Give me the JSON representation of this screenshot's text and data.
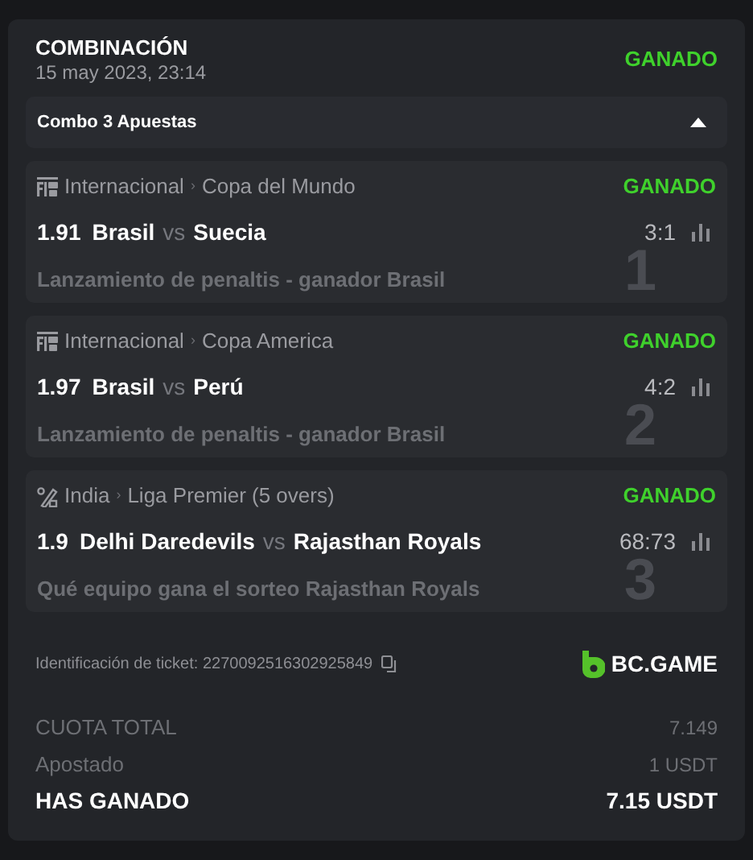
{
  "header": {
    "title": "COMBINACIÓN",
    "date": "15 may 2023, 23:14",
    "status": "GANADO"
  },
  "combo": {
    "label": "Combo 3 Apuestas",
    "expanded": true
  },
  "bets": [
    {
      "kind": "fifa",
      "country": "Internacional",
      "separator": "›",
      "league": "Copa del Mundo",
      "status": "GANADO",
      "odds": "1.91",
      "home": "Brasil",
      "vs": "vs",
      "away": "Suecia",
      "score": "3:1",
      "market": "Lanzamiento de penaltis - ganador Brasil",
      "index": "1"
    },
    {
      "kind": "fifa",
      "country": "Internacional",
      "separator": "›",
      "league": "Copa America",
      "status": "GANADO",
      "odds": "1.97",
      "home": "Brasil",
      "vs": "vs",
      "away": "Perú",
      "score": "4:2",
      "market": "Lanzamiento de penaltis - ganador Brasil",
      "index": "2"
    },
    {
      "kind": "cricket",
      "country": "India",
      "separator": "›",
      "league": "Liga Premier (5 overs)",
      "status": "GANADO",
      "odds": "1.9",
      "home": "Delhi Daredevils",
      "vs": "vs",
      "away": "Rajasthan Royals",
      "score": "68:73",
      "market": "Qué equipo gana el sorteo Rajasthan Royals",
      "index": "3"
    }
  ],
  "ticket": {
    "label": "Identificación de ticket: 2270092516302925849",
    "brand": "BC.GAME"
  },
  "totals": [
    {
      "kind": "plain",
      "label": "CUOTA TOTAL",
      "value": "7.149"
    },
    {
      "kind": "plain",
      "label": "Apostado",
      "value": "1 USDT"
    },
    {
      "kind": "strong",
      "label": "HAS GANADO",
      "value": "7.15 USDT"
    }
  ]
}
